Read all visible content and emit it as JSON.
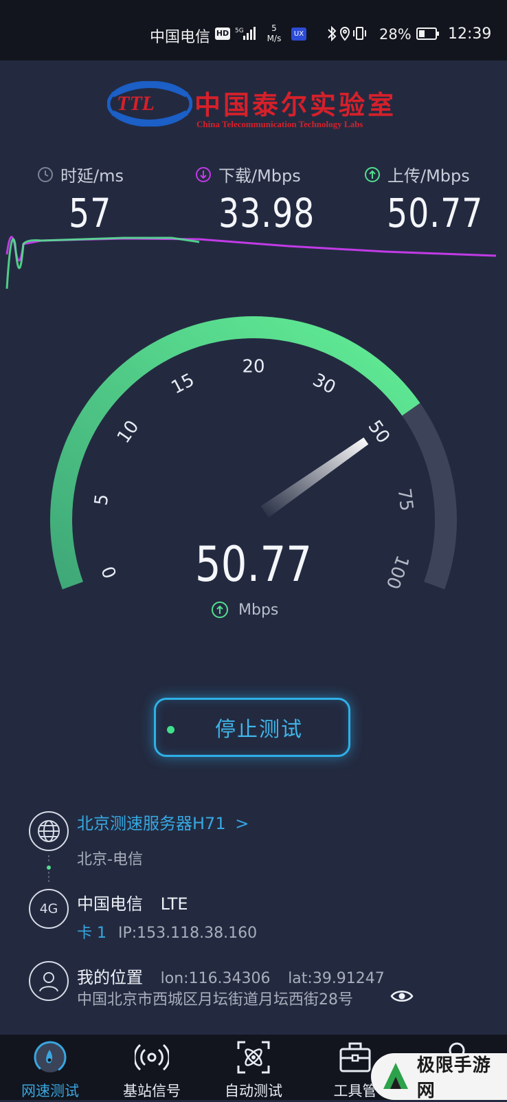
{
  "status_bar": {
    "carrier": "中国电信",
    "hd_badge": "HD",
    "net_speed_value": "5",
    "net_speed_unit": "M/s",
    "ux_badge": "UX",
    "battery": "28%",
    "time": "12:39"
  },
  "logo": {
    "abbr": "TTL",
    "name_cn": "中国泰尔实验室",
    "name_en": "China Telecommunication Technology Labs"
  },
  "metrics": {
    "latency": {
      "label": "时延/ms",
      "value": "57"
    },
    "download": {
      "label": "下载/Mbps",
      "value": "33.98"
    },
    "upload": {
      "label": "上传/Mbps",
      "value": "50.77"
    }
  },
  "gauge": {
    "ticks": [
      "0",
      "5",
      "10",
      "15",
      "20",
      "30",
      "50",
      "75",
      "100"
    ],
    "value": "50.77",
    "unit": "Mbps",
    "max_fraction": 1.0,
    "fill_fraction": 0.75
  },
  "colors": {
    "download": "#c23be6",
    "upload": "#53e08e",
    "latency": "#7d8496",
    "accent": "#36a8e2",
    "gauge_green": "#53e08e"
  },
  "stop_button": {
    "label": "停止测试"
  },
  "server": {
    "name": "北京测速服务器H71",
    "chevron": ">",
    "sub": "北京-电信"
  },
  "network": {
    "badge": "4G",
    "carrier": "中国电信",
    "type": "LTE",
    "sim": "卡 1",
    "ip": "IP:153.118.38.160"
  },
  "location": {
    "title": "我的位置",
    "lon": "lon:116.34306",
    "lat": "lat:39.91247",
    "address": "中国北京市西城区月坛街道月坛西街28号"
  },
  "nav": {
    "items": [
      {
        "label": "网速测试",
        "icon": "speed-test-icon"
      },
      {
        "label": "基站信号",
        "icon": "signal-icon"
      },
      {
        "label": "自动测试",
        "icon": "auto-test-icon"
      },
      {
        "label": "工具管",
        "icon": "toolbox-icon"
      },
      {
        "label": "",
        "icon": "person-icon"
      }
    ]
  },
  "watermark": {
    "text": "极限手游网"
  }
}
